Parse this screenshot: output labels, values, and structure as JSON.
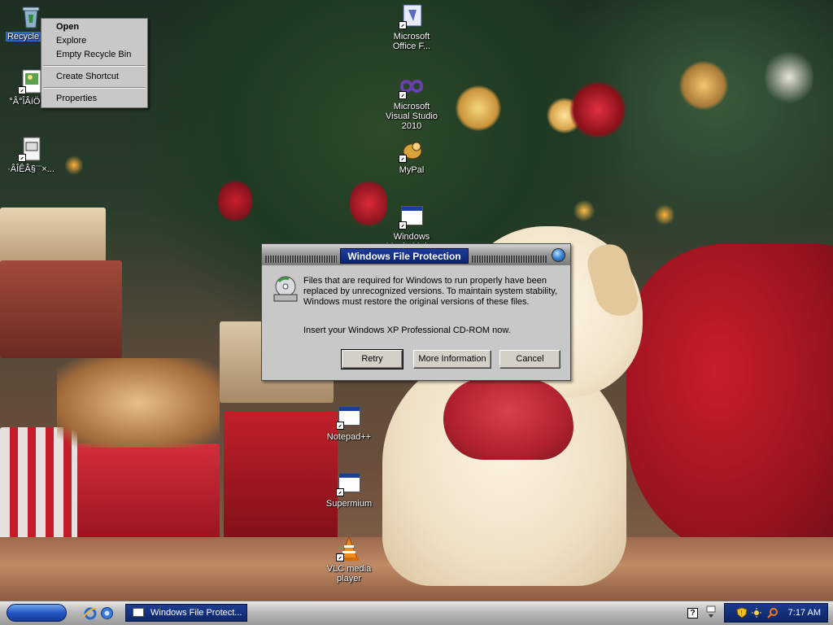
{
  "desktop": {
    "icons": [
      {
        "label": "Recycle Bin"
      },
      {
        "label": "°Â°ÎÂíÖ÷Ìâ"
      },
      {
        "label": "·ÂÎÊÂ§¨¨×..."
      },
      {
        "label": "Microsoft Office F..."
      },
      {
        "label": "Microsoft Visual Studio 2010"
      },
      {
        "label": "MyPal"
      },
      {
        "label": "Windows Movie Maker"
      },
      {
        "label": "Notepad++"
      },
      {
        "label": "Supermium"
      },
      {
        "label": "VLC media player"
      }
    ]
  },
  "context_menu": {
    "items": [
      "Open",
      "Explore",
      "Empty Recycle Bin",
      "Create Shortcut",
      "Properties"
    ]
  },
  "dialog": {
    "title": "Windows File Protection",
    "message": "Files that are required for Windows to run properly have been replaced by unrecognized versions.  To maintain system stability, Windows must restore the original versions of these files.",
    "prompt": "Insert your Windows XP Professional CD-ROM now.",
    "buttons": {
      "retry": "Retry",
      "more_info": "More Information",
      "cancel": "Cancel"
    }
  },
  "taskbar": {
    "task_button": "Windows File Protect...",
    "help_glyph": "?",
    "clock": "7:17 AM"
  },
  "colors": {
    "title_accent": "#0a2472",
    "taskbar_tray": "#0b2466",
    "selection": "#316ac5"
  }
}
